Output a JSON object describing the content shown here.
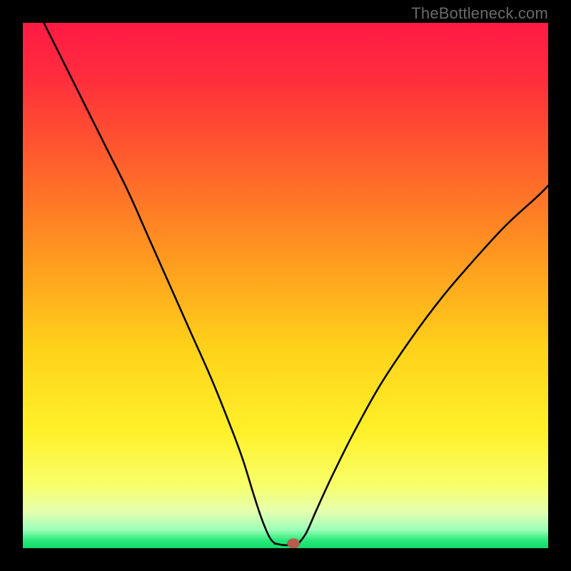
{
  "watermark": "TheBottleneck.com",
  "chart_data": {
    "type": "line",
    "title": "",
    "xlabel": "",
    "ylabel": "",
    "xlim": [
      0,
      100
    ],
    "ylim": [
      0,
      100
    ],
    "grid": false,
    "legend": false,
    "gradient_stops": [
      {
        "offset": 0.0,
        "color": "#ff1a44"
      },
      {
        "offset": 0.1,
        "color": "#ff2c3d"
      },
      {
        "offset": 0.25,
        "color": "#ff5a2e"
      },
      {
        "offset": 0.45,
        "color": "#ff9a1f"
      },
      {
        "offset": 0.62,
        "color": "#ffd21a"
      },
      {
        "offset": 0.78,
        "color": "#fff12a"
      },
      {
        "offset": 0.88,
        "color": "#f8ff6a"
      },
      {
        "offset": 0.93,
        "color": "#e6ffb0"
      },
      {
        "offset": 0.965,
        "color": "#9dffb8"
      },
      {
        "offset": 0.985,
        "color": "#28e97a"
      },
      {
        "offset": 1.0,
        "color": "#14d96a"
      }
    ],
    "series": [
      {
        "name": "left-branch",
        "x": [
          4,
          8,
          12,
          16,
          20,
          24,
          28,
          32,
          36,
          40,
          42,
          44,
          45.5,
          47,
          48
        ],
        "y": [
          100,
          92,
          84,
          76,
          68,
          59,
          50,
          41,
          32,
          22,
          16.5,
          10,
          5.5,
          2,
          0.9
        ]
      },
      {
        "name": "flat-bottom",
        "x": [
          48,
          49.5,
          51,
          52.5
        ],
        "y": [
          0.9,
          0.6,
          0.6,
          0.9
        ]
      },
      {
        "name": "right-branch",
        "x": [
          52.5,
          54,
          56,
          59,
          63,
          68,
          74,
          80,
          86,
          92,
          98,
          100
        ],
        "y": [
          0.9,
          3,
          7.5,
          14,
          22,
          31,
          40,
          48,
          55,
          61.5,
          67,
          69
        ]
      }
    ],
    "marker": {
      "x": 51.5,
      "y": 0.9,
      "rx": 1.2,
      "ry": 0.95,
      "color": "#b85a4d"
    }
  }
}
